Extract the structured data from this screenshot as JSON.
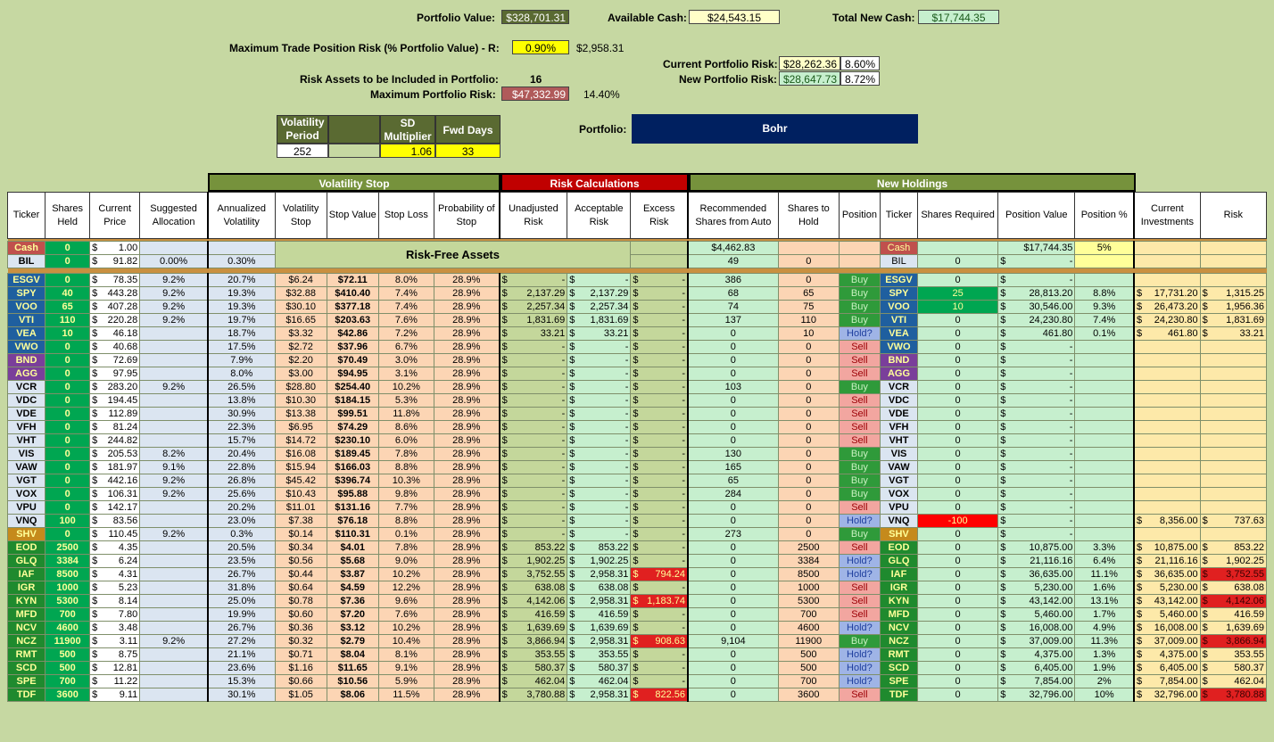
{
  "top": {
    "portfolio_value_label": "Portfolio Value:",
    "portfolio_value": "$328,701.31",
    "available_cash_label": "Available Cash:",
    "available_cash": "$24,543.15",
    "total_new_cash_label": "Total New Cash:",
    "total_new_cash": "$17,744.35",
    "max_trade_label": "Maximum Trade Position Risk (% Portfolio Value) - R:",
    "max_trade_pct": "0.90%",
    "max_trade_value": "$2,958.31",
    "current_risk_label": "Current Portfolio Risk:",
    "current_risk_value": "$28,262.36",
    "current_risk_pct": "8.60%",
    "new_risk_label": "New Portfolio Risk:",
    "new_risk_value": "$28,647.73",
    "new_risk_pct": "8.72%",
    "risk_assets_label": "Risk Assets to be Included in Portfolio:",
    "risk_assets_count": "16",
    "max_portfolio_risk_label": "Maximum Portfolio Risk:",
    "max_portfolio_risk_value": "$47,332.99",
    "max_portfolio_risk_pct": "14.40%",
    "vol_period_label": "Volatility Period",
    "vol_period": "252",
    "sd_mult_label": "SD Multiplier",
    "sd_mult": "1.06",
    "fwd_days_label": "Fwd Days",
    "fwd_days": "33",
    "portfolio_label": "Portfolio:",
    "portfolio_name": "Bohr"
  },
  "groups": {
    "vol_stop": "Volatility Stop",
    "risk_calc": "Risk Calculations",
    "new_holdings": "New Holdings"
  },
  "headers": [
    "Ticker",
    "Shares Held",
    "Current Price",
    "Suggested Allocation",
    "Annualized Volatility",
    "Volatility Stop",
    "Stop Value",
    "Stop Loss",
    "Probability of Stop",
    "Unadjusted Risk",
    "Acceptable Risk",
    "Excess Risk",
    "Recommended Shares from Auto",
    "Shares to Hold",
    "Position",
    "Ticker",
    "Shares Required",
    "Position Value",
    "Position %",
    "Current Investments",
    "Risk"
  ],
  "risk_free_label": "Risk-Free Assets",
  "cash_rows": [
    {
      "t": "Cash",
      "sh": "0",
      "pr": "1.00",
      "alloc": "",
      "vol": "",
      "rec": "$4,462.83",
      "hold": "",
      "pos": "",
      "t2": "Cash",
      "req": "",
      "val": "$17,744.35",
      "pct": "5%",
      "ci": "",
      "risk": ""
    },
    {
      "t": "BIL",
      "sh": "0",
      "pr": "91.82",
      "alloc": "0.00%",
      "vol": "0.30%",
      "rec": "49",
      "hold": "0",
      "pos": "",
      "t2": "BIL",
      "req": "0",
      "val": "-",
      "pct": "",
      "ci": "",
      "risk": ""
    }
  ],
  "rows": [
    [
      "ESGV",
      "0",
      "78.35",
      "9.2%",
      "20.7%",
      "$6.24",
      "$72.11",
      "8.0%",
      "28.9%",
      "-",
      "-",
      "-",
      "386",
      "0",
      "Buy",
      "ESGV",
      "0",
      "-",
      "",
      "",
      ""
    ],
    [
      "SPY",
      "40",
      "443.28",
      "9.2%",
      "19.3%",
      "$32.88",
      "$410.40",
      "7.4%",
      "28.9%",
      "2,137.29",
      "2,137.29",
      "-",
      "68",
      "65",
      "Buy",
      "SPY",
      "25",
      "28,813.20",
      "8.8%",
      "17,731.20",
      "1,315.25"
    ],
    [
      "VOO",
      "65",
      "407.28",
      "9.2%",
      "19.3%",
      "$30.10",
      "$377.18",
      "7.4%",
      "28.9%",
      "2,257.34",
      "2,257.34",
      "-",
      "74",
      "75",
      "Buy",
      "VOO",
      "10",
      "30,546.00",
      "9.3%",
      "26,473.20",
      "1,956.36"
    ],
    [
      "VTI",
      "110",
      "220.28",
      "9.2%",
      "19.7%",
      "$16.65",
      "$203.63",
      "7.6%",
      "28.9%",
      "1,831.69",
      "1,831.69",
      "-",
      "137",
      "110",
      "Buy",
      "VTI",
      "0",
      "24,230.80",
      "7.4%",
      "24,230.80",
      "1,831.69"
    ],
    [
      "VEA",
      "10",
      "46.18",
      "",
      "18.7%",
      "$3.32",
      "$42.86",
      "7.2%",
      "28.9%",
      "33.21",
      "33.21",
      "-",
      "0",
      "10",
      "Hold?",
      "VEA",
      "0",
      "461.80",
      "0.1%",
      "461.80",
      "33.21"
    ],
    [
      "VWO",
      "0",
      "40.68",
      "",
      "17.5%",
      "$2.72",
      "$37.96",
      "6.7%",
      "28.9%",
      "-",
      "-",
      "-",
      "0",
      "0",
      "Sell",
      "VWO",
      "0",
      "-",
      "",
      "",
      ""
    ],
    [
      "BND",
      "0",
      "72.69",
      "",
      "7.9%",
      "$2.20",
      "$70.49",
      "3.0%",
      "28.9%",
      "-",
      "-",
      "-",
      "0",
      "0",
      "Sell",
      "BND",
      "0",
      "-",
      "",
      "",
      ""
    ],
    [
      "AGG",
      "0",
      "97.95",
      "",
      "8.0%",
      "$3.00",
      "$94.95",
      "3.1%",
      "28.9%",
      "-",
      "-",
      "-",
      "0",
      "0",
      "Sell",
      "AGG",
      "0",
      "-",
      "",
      "",
      ""
    ],
    [
      "VCR",
      "0",
      "283.20",
      "9.2%",
      "26.5%",
      "$28.80",
      "$254.40",
      "10.2%",
      "28.9%",
      "-",
      "-",
      "-",
      "103",
      "0",
      "Buy",
      "VCR",
      "0",
      "-",
      "",
      "",
      ""
    ],
    [
      "VDC",
      "0",
      "194.45",
      "",
      "13.8%",
      "$10.30",
      "$184.15",
      "5.3%",
      "28.9%",
      "-",
      "-",
      "-",
      "0",
      "0",
      "Sell",
      "VDC",
      "0",
      "-",
      "",
      "",
      ""
    ],
    [
      "VDE",
      "0",
      "112.89",
      "",
      "30.9%",
      "$13.38",
      "$99.51",
      "11.8%",
      "28.9%",
      "-",
      "-",
      "-",
      "0",
      "0",
      "Sell",
      "VDE",
      "0",
      "-",
      "",
      "",
      ""
    ],
    [
      "VFH",
      "0",
      "81.24",
      "",
      "22.3%",
      "$6.95",
      "$74.29",
      "8.6%",
      "28.9%",
      "-",
      "-",
      "-",
      "0",
      "0",
      "Sell",
      "VFH",
      "0",
      "-",
      "",
      "",
      ""
    ],
    [
      "VHT",
      "0",
      "244.82",
      "",
      "15.7%",
      "$14.72",
      "$230.10",
      "6.0%",
      "28.9%",
      "-",
      "-",
      "-",
      "0",
      "0",
      "Sell",
      "VHT",
      "0",
      "-",
      "",
      "",
      ""
    ],
    [
      "VIS",
      "0",
      "205.53",
      "8.2%",
      "20.4%",
      "$16.08",
      "$189.45",
      "7.8%",
      "28.9%",
      "-",
      "-",
      "-",
      "130",
      "0",
      "Buy",
      "VIS",
      "0",
      "-",
      "",
      "",
      ""
    ],
    [
      "VAW",
      "0",
      "181.97",
      "9.1%",
      "22.8%",
      "$15.94",
      "$166.03",
      "8.8%",
      "28.9%",
      "-",
      "-",
      "-",
      "165",
      "0",
      "Buy",
      "VAW",
      "0",
      "-",
      "",
      "",
      ""
    ],
    [
      "VGT",
      "0",
      "442.16",
      "9.2%",
      "26.8%",
      "$45.42",
      "$396.74",
      "10.3%",
      "28.9%",
      "-",
      "-",
      "-",
      "65",
      "0",
      "Buy",
      "VGT",
      "0",
      "-",
      "",
      "",
      ""
    ],
    [
      "VOX",
      "0",
      "106.31",
      "9.2%",
      "25.6%",
      "$10.43",
      "$95.88",
      "9.8%",
      "28.9%",
      "-",
      "-",
      "-",
      "284",
      "0",
      "Buy",
      "VOX",
      "0",
      "-",
      "",
      "",
      ""
    ],
    [
      "VPU",
      "0",
      "142.17",
      "",
      "20.2%",
      "$11.01",
      "$131.16",
      "7.7%",
      "28.9%",
      "-",
      "-",
      "-",
      "0",
      "0",
      "Sell",
      "VPU",
      "0",
      "-",
      "",
      "",
      ""
    ],
    [
      "VNQ",
      "100",
      "83.56",
      "",
      "23.0%",
      "$7.38",
      "$76.18",
      "8.8%",
      "28.9%",
      "-",
      "-",
      "-",
      "0",
      "0",
      "Hold?",
      "VNQ",
      "-100",
      "-",
      "",
      "8,356.00",
      "737.63"
    ],
    [
      "SHV",
      "0",
      "110.45",
      "9.2%",
      "0.3%",
      "$0.14",
      "$110.31",
      "0.1%",
      "28.9%",
      "-",
      "-",
      "-",
      "273",
      "0",
      "Buy",
      "SHV",
      "0",
      "-",
      "",
      "",
      ""
    ],
    [
      "EOD",
      "2500",
      "4.35",
      "",
      "20.5%",
      "$0.34",
      "$4.01",
      "7.8%",
      "28.9%",
      "853.22",
      "853.22",
      "-",
      "0",
      "2500",
      "Sell",
      "EOD",
      "0",
      "10,875.00",
      "3.3%",
      "10,875.00",
      "853.22"
    ],
    [
      "GLQ",
      "3384",
      "6.24",
      "",
      "23.5%",
      "$0.56",
      "$5.68",
      "9.0%",
      "28.9%",
      "1,902.25",
      "1,902.25",
      "-",
      "0",
      "3384",
      "Hold?",
      "GLQ",
      "0",
      "21,116.16",
      "6.4%",
      "21,116.16",
      "1,902.25"
    ],
    [
      "IAF",
      "8500",
      "4.31",
      "",
      "26.7%",
      "$0.44",
      "$3.87",
      "10.2%",
      "28.9%",
      "3,752.55",
      "2,958.31",
      "794.24",
      "0",
      "8500",
      "Hold?",
      "IAF",
      "0",
      "36,635.00",
      "11.1%",
      "36,635.00",
      "3,752.55"
    ],
    [
      "IGR",
      "1000",
      "5.23",
      "",
      "31.8%",
      "$0.64",
      "$4.59",
      "12.2%",
      "28.9%",
      "638.08",
      "638.08",
      "-",
      "0",
      "1000",
      "Sell",
      "IGR",
      "0",
      "5,230.00",
      "1.6%",
      "5,230.00",
      "638.08"
    ],
    [
      "KYN",
      "5300",
      "8.14",
      "",
      "25.0%",
      "$0.78",
      "$7.36",
      "9.6%",
      "28.9%",
      "4,142.06",
      "2,958.31",
      "1,183.74",
      "0",
      "5300",
      "Sell",
      "KYN",
      "0",
      "43,142.00",
      "13.1%",
      "43,142.00",
      "4,142.06"
    ],
    [
      "MFD",
      "700",
      "7.80",
      "",
      "19.9%",
      "$0.60",
      "$7.20",
      "7.6%",
      "28.9%",
      "416.59",
      "416.59",
      "-",
      "0",
      "700",
      "Sell",
      "MFD",
      "0",
      "5,460.00",
      "1.7%",
      "5,460.00",
      "416.59"
    ],
    [
      "NCV",
      "4600",
      "3.48",
      "",
      "26.7%",
      "$0.36",
      "$3.12",
      "10.2%",
      "28.9%",
      "1,639.69",
      "1,639.69",
      "-",
      "0",
      "4600",
      "Hold?",
      "NCV",
      "0",
      "16,008.00",
      "4.9%",
      "16,008.00",
      "1,639.69"
    ],
    [
      "NCZ",
      "11900",
      "3.11",
      "9.2%",
      "27.2%",
      "$0.32",
      "$2.79",
      "10.4%",
      "28.9%",
      "3,866.94",
      "2,958.31",
      "908.63",
      "9,104",
      "11900",
      "Buy",
      "NCZ",
      "0",
      "37,009.00",
      "11.3%",
      "37,009.00",
      "3,866.94"
    ],
    [
      "RMT",
      "500",
      "8.75",
      "",
      "21.1%",
      "$0.71",
      "$8.04",
      "8.1%",
      "28.9%",
      "353.55",
      "353.55",
      "-",
      "0",
      "500",
      "Hold?",
      "RMT",
      "0",
      "4,375.00",
      "1.3%",
      "4,375.00",
      "353.55"
    ],
    [
      "SCD",
      "500",
      "12.81",
      "",
      "23.6%",
      "$1.16",
      "$11.65",
      "9.1%",
      "28.9%",
      "580.37",
      "580.37",
      "-",
      "0",
      "500",
      "Hold?",
      "SCD",
      "0",
      "6,405.00",
      "1.9%",
      "6,405.00",
      "580.37"
    ],
    [
      "SPE",
      "700",
      "11.22",
      "",
      "15.3%",
      "$0.66",
      "$10.56",
      "5.9%",
      "28.9%",
      "462.04",
      "462.04",
      "-",
      "0",
      "700",
      "Hold?",
      "SPE",
      "0",
      "7,854.00",
      "2%",
      "7,854.00",
      "462.04"
    ],
    [
      "TDF",
      "3600",
      "9.11",
      "",
      "30.1%",
      "$1.05",
      "$8.06",
      "11.5%",
      "28.9%",
      "3,780.88",
      "2,958.31",
      "822.56",
      "0",
      "3600",
      "Sell",
      "TDF",
      "0",
      "32,796.00",
      "10%",
      "32,796.00",
      "3,780.88"
    ]
  ],
  "colors": {
    "etf_ticker": "#1f5f9f",
    "bond_ticker": "#7a3f9a",
    "cef_ticker": "#1f8a2e",
    "shv_ticker": "#c58a1c",
    "buy": "#2f9a3a",
    "sell": "#f2a6a0",
    "hold": "#9fb4e6",
    "excess": "#e02020"
  }
}
